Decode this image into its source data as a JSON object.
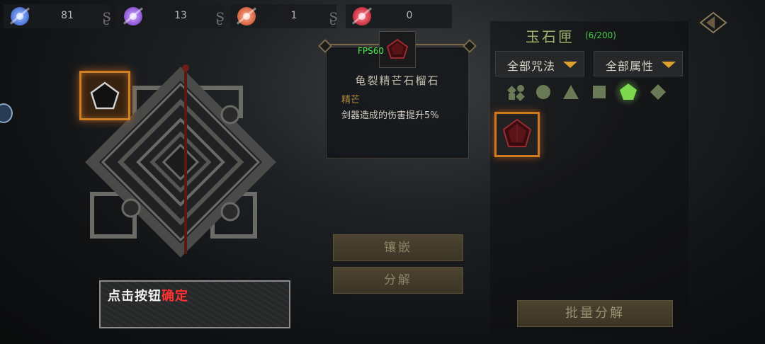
{
  "currencies": [
    {
      "value": "81",
      "color": "#5a8cff",
      "icon": "blue-essence-orb-icon"
    },
    {
      "value": "13",
      "color": "#a46aff",
      "icon": "purple-essence-orb-icon"
    },
    {
      "value": "1",
      "color": "#ff7040",
      "icon": "orange-essence-orb-icon"
    },
    {
      "value": "0",
      "color": "#ff3040",
      "icon": "red-essence-orb-icon"
    }
  ],
  "debug": {
    "fps": "FPS60"
  },
  "item": {
    "name": "龟裂精芒石榴石",
    "tag": "精芒",
    "description": "剑器造成的伤害提升5%"
  },
  "actions": {
    "inlay": "镶嵌",
    "decompose": "分解"
  },
  "hint": {
    "prefix": "点击按钮",
    "highlight": "确定"
  },
  "inventory": {
    "title": "玉石匣",
    "count": "(6/200)",
    "filter_spell": "全部咒法",
    "filter_attr": "全部属性",
    "shape_filters": [
      "all-shapes-icon",
      "circle-icon",
      "triangle-icon",
      "square-icon",
      "pentagon-icon",
      "diamond-icon"
    ],
    "selected_filter": "pentagon-icon",
    "batch_decompose": "批量分解"
  },
  "colors": {
    "accent_gold": "#e0a030",
    "highlight_orange": "#d08020",
    "count_green": "#4ac84a"
  }
}
